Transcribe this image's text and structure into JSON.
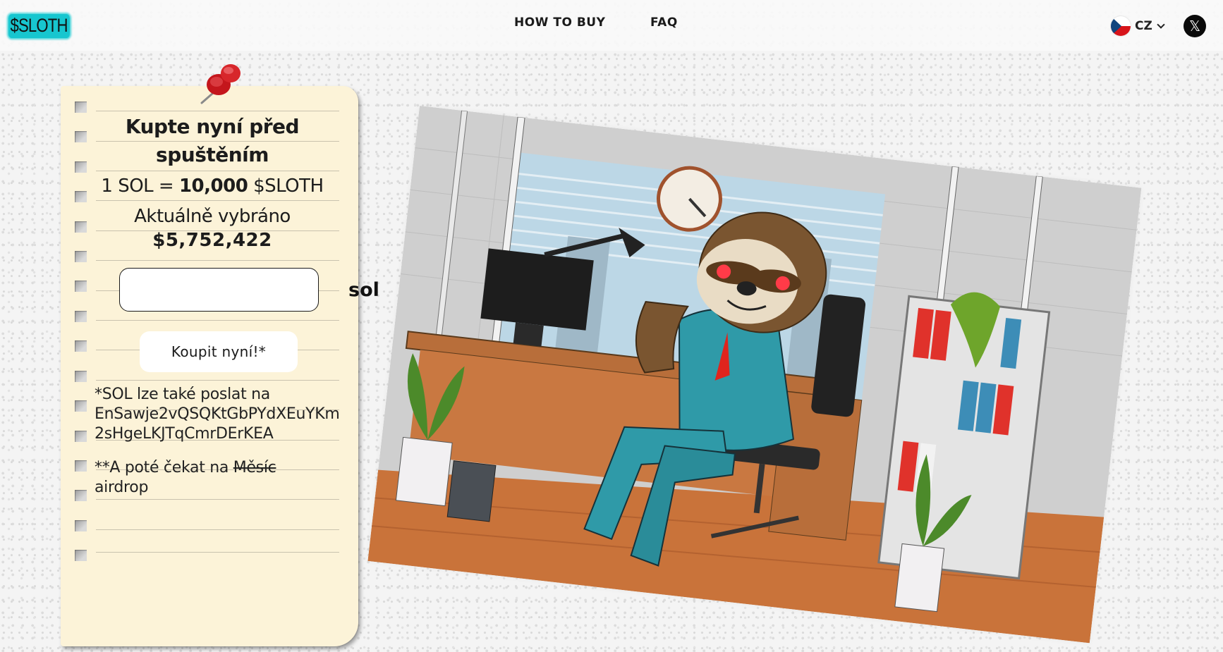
{
  "header": {
    "logo": "$SLOTH",
    "nav": [
      {
        "label": "HOW TO BUY"
      },
      {
        "label": "FAQ"
      }
    ],
    "language": {
      "code": "CZ",
      "flag": "czech-flag"
    },
    "social": {
      "x_label": "𝕏"
    }
  },
  "presale": {
    "title": "Kupte nyní před spuštěním",
    "rate_prefix": "1 SOL = ",
    "rate_amount": "10,000",
    "rate_suffix": " $SLOTH",
    "raised_label": "Aktuálně vybráno",
    "raised_value": "$5,752,422",
    "amount_input": {
      "value": "",
      "placeholder": "",
      "unit": "sol"
    },
    "buy_button": "Koupit nyní!*",
    "note_send_prefix": "*SOL lze také poslat na",
    "wallet_address": "EnSawje2vQSQKtGbPYdXEuYKm2sHgeLKJTqCmrDErKEA",
    "note_wait_prefix": "**A poté čekat na ",
    "note_wait_strike": "Měsíc",
    "note_wait_suffix": "airdrop"
  },
  "illustration": {
    "subject": "sloth in teal suit relaxing in office chair",
    "colors": {
      "accent": "#17c6cf",
      "pin": "#d8262c",
      "paper": "#fcf3d8"
    }
  }
}
